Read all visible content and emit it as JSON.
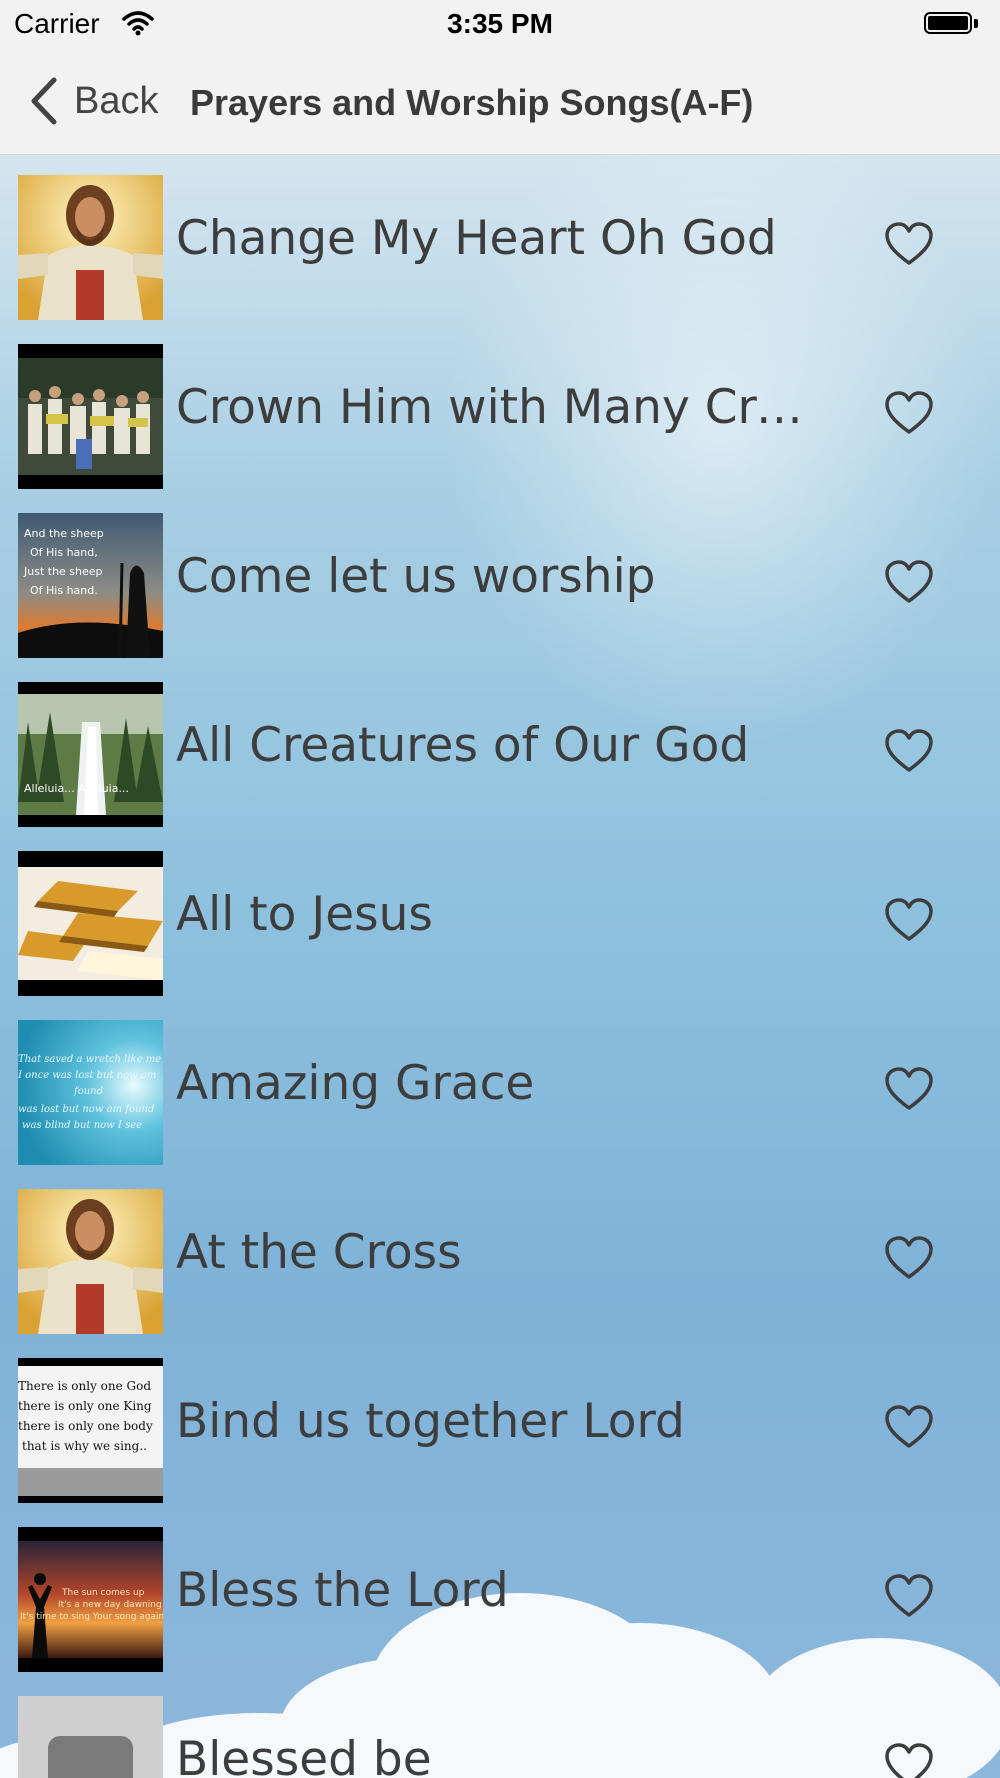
{
  "status_bar": {
    "carrier": "Carrier",
    "time": "3:35 PM"
  },
  "nav": {
    "back_label": "Back",
    "title": "Prayers and Worship Songs(A-F)"
  },
  "songs": [
    {
      "title": "Change My Heart Oh God",
      "thumb": "jesus-portrait"
    },
    {
      "title": "Crown Him with Many Cro...",
      "thumb": "choir-crowd"
    },
    {
      "title": "Come let us worship",
      "thumb": "shepherd-sunset"
    },
    {
      "title": "All Creatures of Our God",
      "thumb": "waterfall-forest"
    },
    {
      "title": "All to Jesus",
      "thumb": "golden-abstract"
    },
    {
      "title": "Amazing Grace",
      "thumb": "sky-lyrics"
    },
    {
      "title": "At the Cross",
      "thumb": "jesus-portrait"
    },
    {
      "title": "Bind us together Lord",
      "thumb": "text-lyrics"
    },
    {
      "title": "Bless the Lord",
      "thumb": "sunrise-silhouette"
    },
    {
      "title": "Blessed be",
      "thumb": "gray-placeholder"
    }
  ],
  "thumb_text": {
    "shepherd": [
      "And the sheep",
      "Of His hand,",
      "Just the sheep",
      "Of His hand."
    ],
    "waterfall": "Alleluia... Alleluia...",
    "grace": [
      "That saved a wretch like me",
      "I once was lost but now am",
      "found",
      "was lost but now am found",
      "was blind but now I see"
    ],
    "bind": [
      "There is only one God",
      "there is only one King",
      "there is only one body",
      "that is why we sing.."
    ],
    "bless": [
      "The sun comes up",
      "It's a new day dawning",
      "It's time to sing Your song again"
    ]
  },
  "colors": {
    "accent": "#3d3d3d",
    "nav_bg": "#f2f2f2"
  }
}
